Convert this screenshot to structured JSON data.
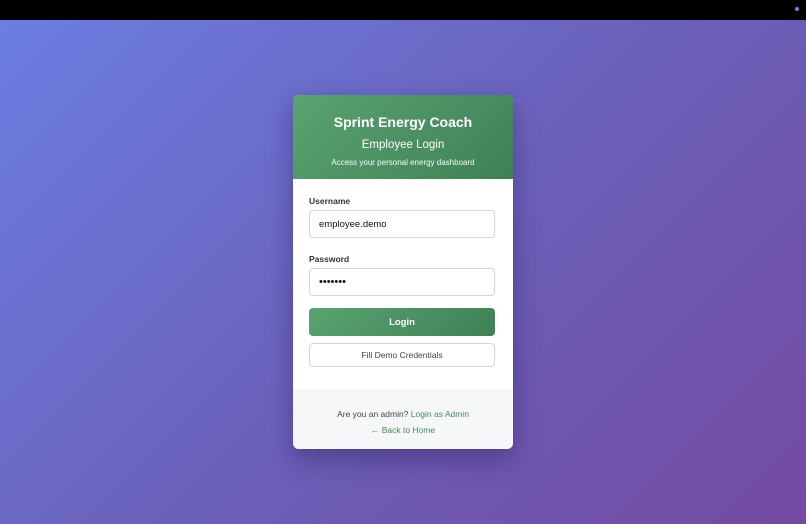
{
  "login_card": {
    "app_title": "Sprint Energy Coach",
    "login_title": "Employee Login",
    "subtitle": "Access your personal energy dashboard",
    "username": {
      "label": "Username",
      "value": "employee.demo"
    },
    "password": {
      "label": "Password",
      "value": "•••••••"
    },
    "login_button": "Login",
    "fill_demo_button": "Fill Demo Credentials",
    "footer": {
      "admin_prompt": "Are you an admin?",
      "admin_link": "Login as Admin",
      "back_link": "← Back to Home"
    }
  },
  "colors": {
    "accent_green": "#4a9163",
    "background_start": "#6b7fe3",
    "background_end": "#744aa1"
  }
}
